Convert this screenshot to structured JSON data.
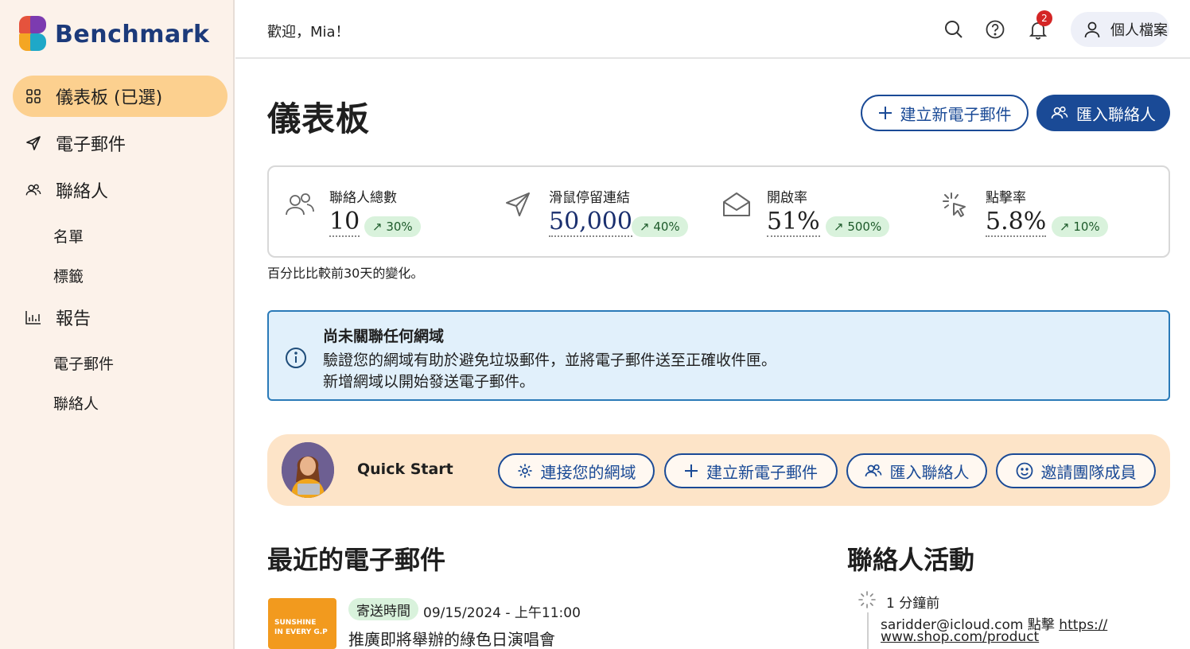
{
  "brand": {
    "name": "Benchmark"
  },
  "sidebar": {
    "items": [
      {
        "label": "儀表板 (已選)",
        "icon": "grid-icon",
        "active": true
      },
      {
        "label": "電子郵件",
        "icon": "send-icon"
      },
      {
        "label": "聯絡人",
        "icon": "contacts-icon"
      },
      {
        "label": "名單"
      },
      {
        "label": "標籤"
      },
      {
        "label": "報告",
        "icon": "bar-chart-icon"
      },
      {
        "label": "電子郵件"
      },
      {
        "label": "聯絡人"
      }
    ]
  },
  "header": {
    "welcome": "歡迎，Mia！",
    "notification_count": "2",
    "profile_label": "個人檔案"
  },
  "main": {
    "title": "儀表板",
    "create_email_label": "建立新電子郵件",
    "import_contacts_label": "匯入聯絡人",
    "stats": [
      {
        "label": "聯絡人總數",
        "value": "10",
        "delta": "30%",
        "icon": "contacts-icon"
      },
      {
        "label": "滑鼠停留連結",
        "value": "50,000",
        "delta": "40%",
        "icon": "send-icon"
      },
      {
        "label": "開啟率",
        "value": "51%",
        "delta": "500%",
        "icon": "open-envelope-icon"
      },
      {
        "label": "點擊率",
        "value": "5.8%",
        "delta": "10%",
        "icon": "cursor-click-icon"
      }
    ],
    "stats_note": "百分比比較前30天的變化。",
    "alert": {
      "title": "尚未關聯任何網域",
      "line1": "驗證您的網域有助於避免垃圾郵件，並將電子郵件送至正確收件匣。",
      "line2": "新增網域以開始發送電子郵件。"
    },
    "quick_start": {
      "label": "Quick Start",
      "buttons": [
        {
          "label": "連接您的網域",
          "icon": "gear-icon"
        },
        {
          "label": "建立新電子郵件",
          "icon": "plus-icon"
        },
        {
          "label": "匯入聯絡人",
          "icon": "contacts-icon"
        },
        {
          "label": "邀請團隊成員",
          "icon": "smile-icon"
        }
      ]
    },
    "recent_emails": {
      "title": "最近的電子郵件",
      "items": [
        {
          "thumb_line1": "SUNSHINE",
          "thumb_line2": "IN EVERY G.P",
          "badge": "寄送時間",
          "time": "09/15/2024 - 上午11:00",
          "subject": "推廣即將舉辦的綠色日演唱會"
        }
      ]
    },
    "contact_activity": {
      "title": "聯絡人活動",
      "items": [
        {
          "time": "1 分鐘前",
          "text_prefix": "saridder@icloud.com 點擊 ",
          "link_part1": "https://",
          "link_part2": "www.shop.com/product"
        }
      ]
    }
  },
  "colors": {
    "brand_blue": "#1a4a96",
    "sidebar_bg": "#fcf2ea",
    "active_nav": "#fcd08f",
    "quick_bg": "#fde4c8",
    "alert_bg": "#e1f0fb",
    "delta_bg": "#d9f2dc"
  }
}
